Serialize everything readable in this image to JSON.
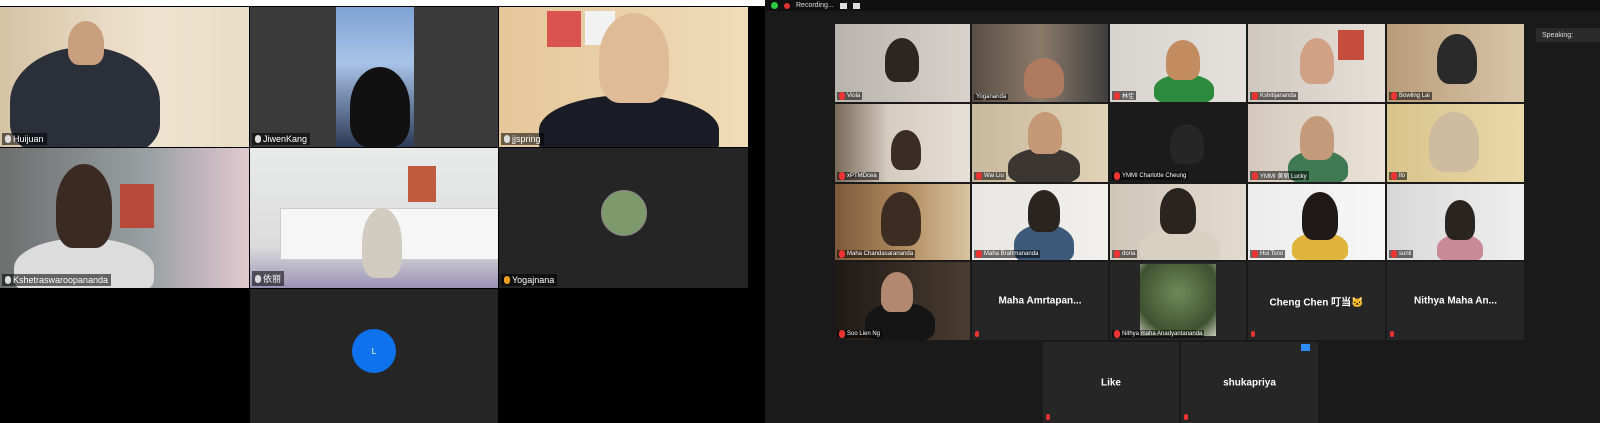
{
  "left_grid": {
    "tiles": [
      {
        "name": "Huijuan"
      },
      {
        "name": "JiwenKang"
      },
      {
        "name": "jjspring"
      },
      {
        "name": "Kshetraswaroopananda"
      },
      {
        "name": "依丽"
      },
      {
        "name": "Yogajnana"
      },
      {
        "avatar_letter": "L"
      }
    ]
  },
  "right_gallery": {
    "recording_label": "Recording...",
    "speaking_label": "Speaking:",
    "tiles": [
      {
        "name": "Viola"
      },
      {
        "name": "Yogananda"
      },
      {
        "name": "林佳"
      },
      {
        "name": "Kshitijananda"
      },
      {
        "name": "Bowling Lai"
      },
      {
        "name": "xPTMDcea"
      },
      {
        "name": "Wai Liu"
      },
      {
        "name": "YMMI Charlotte Cheung"
      },
      {
        "name": "YMMI 黄丽 Lucky"
      },
      {
        "name": "llo"
      },
      {
        "name": "Maha Chandasarananda"
      },
      {
        "name": "Maha Brahmananda"
      },
      {
        "name": "doria"
      },
      {
        "name": "Hui Tsno"
      },
      {
        "name": "sunli"
      },
      {
        "name": "Soo Lien Ng"
      },
      {
        "big_name": "Maha Amrtapan..."
      },
      {
        "name": "Nithya maha Anadyantananda"
      },
      {
        "big_name": "Cheng Chen 叮当🐱"
      },
      {
        "big_name": "Nithya Maha An..."
      },
      {
        "big_name": "Like"
      },
      {
        "big_name": "shukapriya"
      }
    ]
  }
}
